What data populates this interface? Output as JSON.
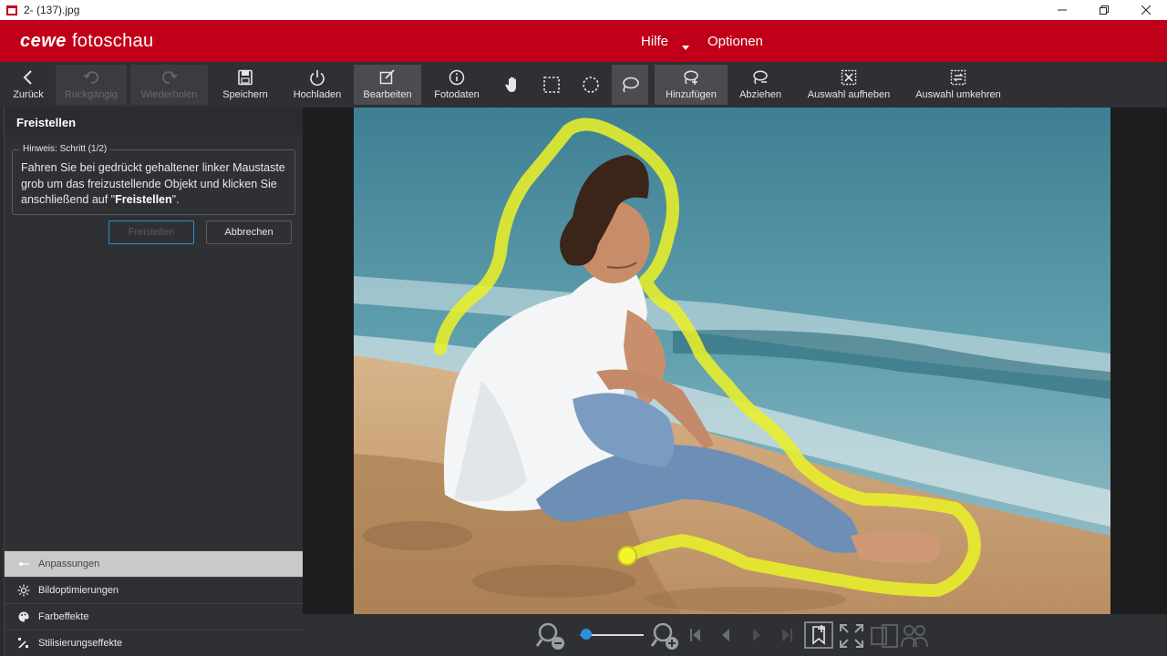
{
  "window": {
    "title": "2- (137).jpg"
  },
  "brand": {
    "name_part1": "cewe",
    "name_part2": "fotoschau",
    "color": "#c00018"
  },
  "menu": {
    "help": "Hilfe",
    "options": "Optionen"
  },
  "toolbar": {
    "back": "Zurück",
    "undo": "Rückgängig",
    "redo": "Wiederholen",
    "save": "Speichern",
    "upload": "Hochladen",
    "edit": "Bearbeiten",
    "photodata": "Fotodaten",
    "add": "Hinzufügen",
    "subtract": "Abziehen",
    "deselect": "Auswahl aufheben",
    "invert": "Auswahl umkehren",
    "icons": [
      "arrow-left-icon",
      "undo-icon",
      "redo-icon",
      "save-icon",
      "power-upload-icon",
      "edit-icon",
      "info-icon",
      "hand-icon",
      "rect-select-icon",
      "ellipse-select-icon",
      "lasso-icon",
      "lasso-add-icon",
      "lasso-subtract-icon",
      "deselect-icon",
      "invert-selection-icon"
    ]
  },
  "panel": {
    "title": "Freistellen",
    "hint_legend": "Hinweis: Schritt (1/2)",
    "hint_text": "Fahren Sie bei gedrückt gehaltener linker Maustaste grob um das freizustellende Objekt und klicken Sie anschließend auf \"",
    "hint_bold": "Freistellen",
    "hint_end": "\".",
    "btn_apply": "Freistellen",
    "btn_cancel": "Abbrechen"
  },
  "sections": [
    {
      "label": "Anpassungen",
      "icon": "adjustments-icon",
      "selected": true
    },
    {
      "label": "Bildoptimierungen",
      "icon": "sun-icon",
      "selected": false
    },
    {
      "label": "Farbeffekte",
      "icon": "palette-icon",
      "selected": false
    },
    {
      "label": "Stilisierungseffekte",
      "icon": "wand-icon",
      "selected": false
    }
  ],
  "zoom": {
    "level_fraction": 0.1,
    "accent": "#2f8fd8"
  }
}
